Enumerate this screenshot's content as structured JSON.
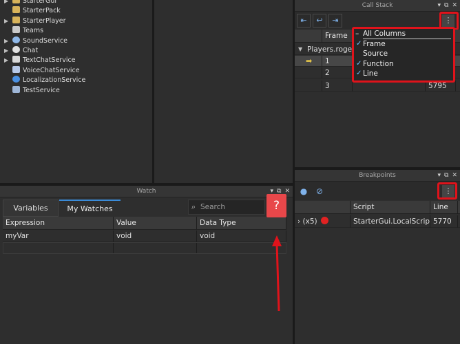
{
  "explorer": {
    "items": [
      {
        "label": "StarterGui",
        "icon": "folder-icon",
        "expandable": true
      },
      {
        "label": "StarterPack",
        "icon": "folder-icon",
        "expandable": false
      },
      {
        "label": "StarterPlayer",
        "icon": "folder-icon",
        "expandable": true
      },
      {
        "label": "Teams",
        "icon": "teams-icon",
        "expandable": false
      },
      {
        "label": "SoundService",
        "icon": "sound-icon",
        "expandable": true
      },
      {
        "label": "Chat",
        "icon": "chat-icon",
        "expandable": true
      },
      {
        "label": "TextChatService",
        "icon": "textchat-icon",
        "expandable": true
      },
      {
        "label": "VoiceChatService",
        "icon": "voicechat-icon",
        "expandable": false
      },
      {
        "label": "LocalizationService",
        "icon": "localization-icon",
        "expandable": false
      },
      {
        "label": "TestService",
        "icon": "test-icon",
        "expandable": false
      }
    ]
  },
  "callstack": {
    "title": "Call Stack",
    "header_frame": "Frame",
    "group_label": "Players.roge",
    "rows": [
      {
        "frame": "1",
        "line": ""
      },
      {
        "frame": "2",
        "line": ""
      },
      {
        "frame": "3",
        "line": "5795"
      }
    ],
    "menu": {
      "all_columns": "All Columns",
      "items": [
        "Frame",
        "Source",
        "Function",
        "Line"
      ]
    }
  },
  "watch": {
    "title": "Watch",
    "tabs": [
      "Variables",
      "My Watches"
    ],
    "active_tab": "My Watches",
    "search_placeholder": "Search",
    "columns": [
      "Expression",
      "Value",
      "Data Type"
    ],
    "rows": [
      {
        "expression": "myVar",
        "value": "void",
        "type": "void"
      }
    ],
    "help_label": "?"
  },
  "breakpoints": {
    "title": "Breakpoints",
    "columns": [
      "Script",
      "Line"
    ],
    "rows": [
      {
        "count": "(x5)",
        "script": "StarterGui.LocalScript",
        "line": "5770"
      }
    ]
  },
  "colors": {
    "accent": "#e0131b",
    "tab_underline": "#3a8bd8",
    "breakpoint": "#e02222"
  }
}
